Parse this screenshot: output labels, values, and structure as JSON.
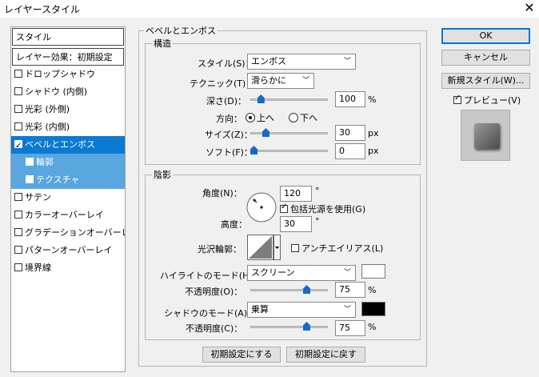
{
  "window": {
    "title": "レイヤースタイル",
    "close_glyph": "✕"
  },
  "left_panel": {
    "header": "スタイル",
    "effects_header": "レイヤー効果：初期設定",
    "items": [
      {
        "label": "ドロップシャドウ",
        "checked": false
      },
      {
        "label": "シャドウ (内側)",
        "checked": false
      },
      {
        "label": "光彩 (外側)",
        "checked": false
      },
      {
        "label": "光彩 (内側)",
        "checked": false
      },
      {
        "label": "ベベルとエンボス",
        "checked": true,
        "selected": true
      },
      {
        "label": "輪郭",
        "checked": false,
        "sub": true
      },
      {
        "label": "テクスチャ",
        "checked": false,
        "sub": true
      },
      {
        "label": "サテン",
        "checked": false
      },
      {
        "label": "カラーオーバーレイ",
        "checked": false
      },
      {
        "label": "グラデーションオーバーレイ",
        "checked": false
      },
      {
        "label": "パターンオーバーレイ",
        "checked": false
      },
      {
        "label": "境界線",
        "checked": false
      }
    ]
  },
  "bevel": {
    "section_title": "ベベルとエンボス",
    "structure": {
      "title": "構造",
      "style_label": "スタイル(S)：",
      "style_value": "エンボス",
      "technique_label": "テクニック(T)：",
      "technique_value": "滑らかに",
      "depth_label": "深さ(D)：",
      "depth_value": "100",
      "depth_unit": "%",
      "depth_fraction": 0.1,
      "direction_label": "方向：",
      "direction_up": "上へ",
      "direction_down": "下へ",
      "direction_selected": "up",
      "size_label": "サイズ(Z)：",
      "size_value": "30",
      "size_unit": "px",
      "size_fraction": 0.17,
      "soften_label": "ソフト(F)：",
      "soften_value": "0",
      "soften_unit": "px",
      "soften_fraction": 0.0
    },
    "shading": {
      "title": "陰影",
      "angle_label": "角度(N)：",
      "angle_value": "120",
      "angle_unit": "°",
      "global_light_label": "包括光源を使用(G)",
      "global_light_checked": true,
      "altitude_label": "高度：",
      "altitude_value": "30",
      "altitude_unit": "°",
      "gloss_label": "光沢輪郭：",
      "antialias_label": "アンチエイリアス(L)",
      "antialias_checked": false,
      "highlight_mode_label": "ハイライトのモード(H)：",
      "highlight_mode_value": "スクリーン",
      "highlight_color": "#ffffff",
      "highlight_opacity_label": "不透明度(O)：",
      "highlight_opacity_value": "75",
      "highlight_opacity_unit": "%",
      "highlight_opacity_fraction": 0.75,
      "shadow_mode_label": "シャドウのモード(A)：",
      "shadow_mode_value": "乗算",
      "shadow_color": "#000000",
      "shadow_opacity_label": "不透明度(C)：",
      "shadow_opacity_value": "75",
      "shadow_opacity_unit": "%",
      "shadow_opacity_fraction": 0.75
    },
    "make_default": "初期設定にする",
    "reset_default": "初期設定に戻す"
  },
  "right_panel": {
    "ok": "OK",
    "cancel": "キャンセル",
    "new_style": "新規スタイル(W)...",
    "preview_label": "プレビュー(V)",
    "preview_checked": true
  },
  "colors": {
    "selection": "#0b7ad2",
    "sub_selection": "#5aa6df",
    "slider_thumb": "#1669c7"
  }
}
